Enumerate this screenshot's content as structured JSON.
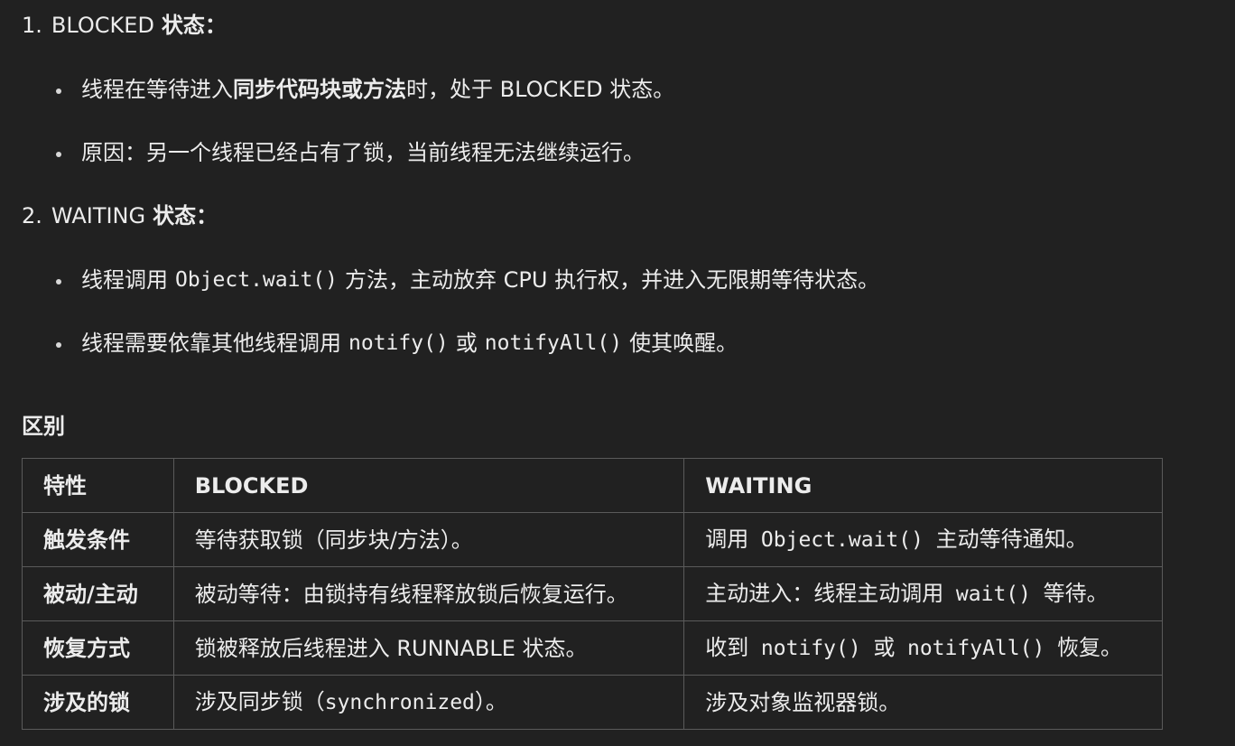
{
  "section1": {
    "number": "1.",
    "title_main": "BLOCKED",
    "title_suffix": "状态：",
    "bullets": [
      {
        "pre": "线程在等待进入",
        "bold": "同步代码块或方法",
        "post": "时，处于 BLOCKED 状态。"
      },
      {
        "text": "原因：另一个线程已经占有了锁，当前线程无法继续运行。"
      }
    ]
  },
  "section2": {
    "number": "2.",
    "title_main": "WAITING",
    "title_suffix": "状态：",
    "bullets": [
      {
        "pre": "线程调用",
        "code": "Object.wait()",
        "post": "方法，主动放弃 CPU 执行权，并进入无限期等待状态。"
      },
      {
        "pre": "线程需要依靠其他线程调用",
        "code1": "notify()",
        "mid": "或",
        "code2": "notifyAll()",
        "post": "使其唤醒。"
      }
    ]
  },
  "diff_heading": "区别",
  "table": {
    "headers": [
      "特性",
      "BLOCKED",
      "WAITING"
    ],
    "rows": [
      {
        "feature": "触发条件",
        "blocked": "等待获取锁（同步块/方法）。",
        "waiting_pre": "调用",
        "waiting_code": "Object.wait()",
        "waiting_post": "主动等待通知。"
      },
      {
        "feature": "被动/主动",
        "blocked": "被动等待：由锁持有线程释放锁后恢复运行。",
        "waiting_pre": "主动进入：线程主动调用",
        "waiting_code": "wait()",
        "waiting_post": "等待。"
      },
      {
        "feature": "恢复方式",
        "blocked": "锁被释放后线程进入 RUNNABLE 状态。",
        "waiting_pre": "收到",
        "waiting_code": "notify()",
        "waiting_mid": "或",
        "waiting_code2": "notifyAll()",
        "waiting_post": "恢复。"
      },
      {
        "feature": "涉及的锁",
        "blocked_pre": "涉及同步锁（",
        "blocked_code": "synchronized",
        "blocked_post": "）。",
        "waiting": "涉及对象监视器锁。"
      }
    ]
  }
}
